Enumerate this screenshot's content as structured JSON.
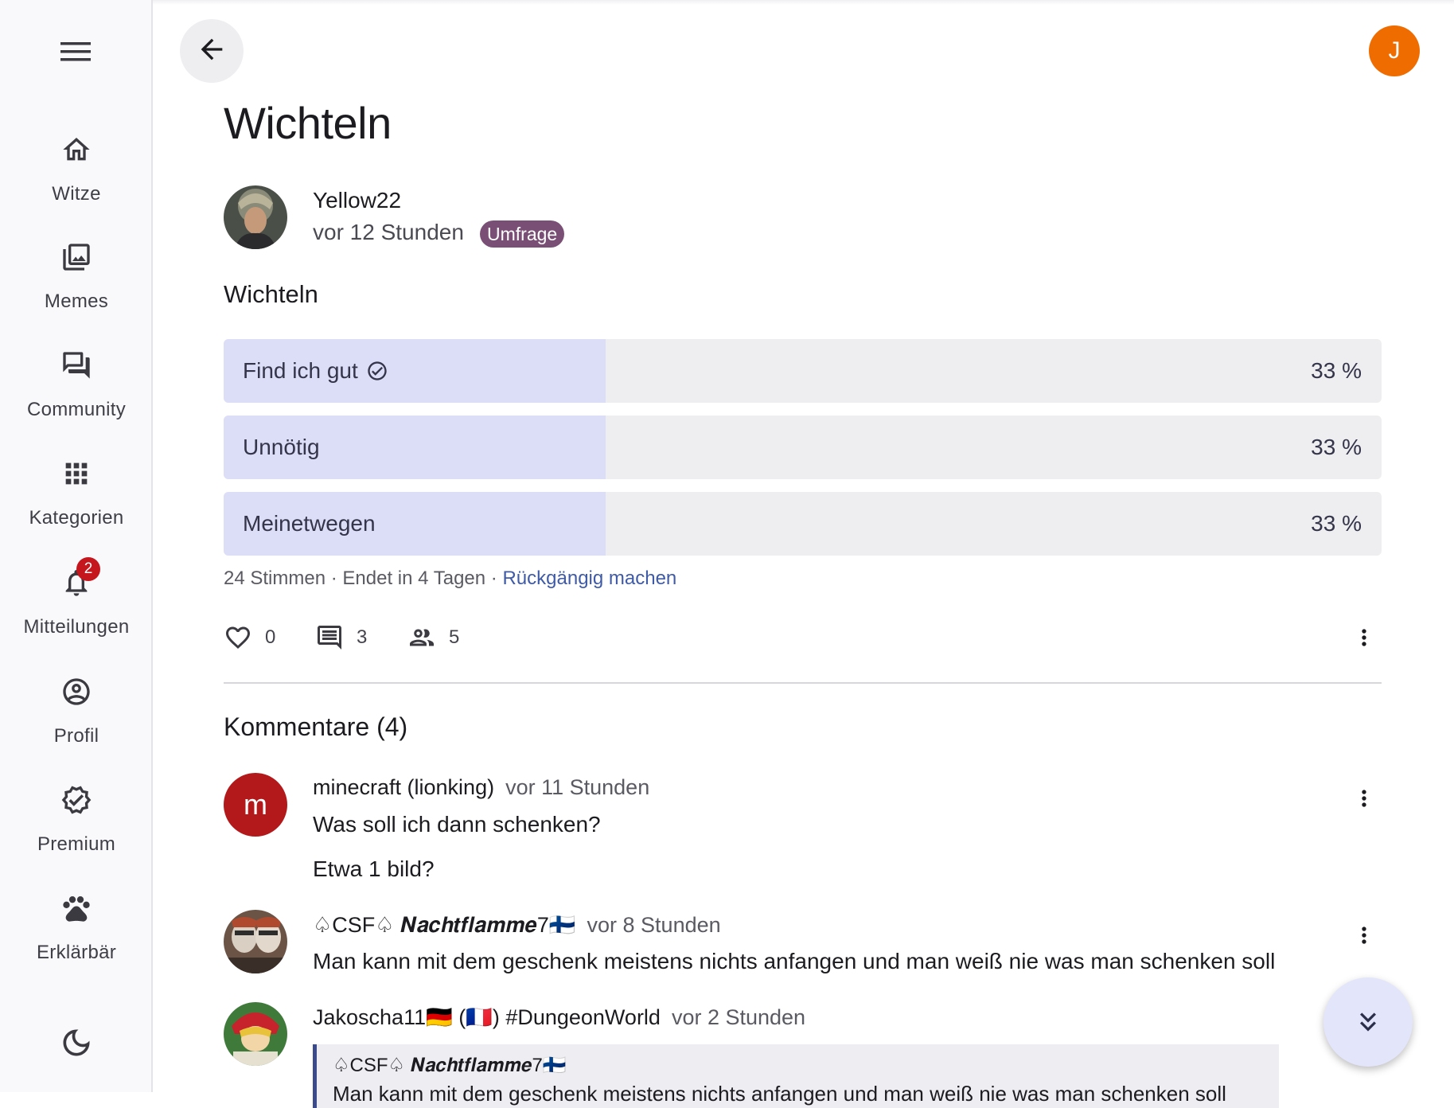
{
  "sidebar": {
    "items": [
      {
        "label": "Witze",
        "icon": "home-icon"
      },
      {
        "label": "Memes",
        "icon": "image-stack-icon"
      },
      {
        "label": "Community",
        "icon": "forum-icon"
      },
      {
        "label": "Kategorien",
        "icon": "apps-grid-icon"
      },
      {
        "label": "Mitteilungen",
        "icon": "bell-icon",
        "badge": "2"
      },
      {
        "label": "Profil",
        "icon": "account-circle-icon"
      },
      {
        "label": "Premium",
        "icon": "verified-icon"
      },
      {
        "label": "Erklärbär",
        "icon": "paw-icon"
      }
    ]
  },
  "header": {
    "user_initial": "J"
  },
  "post": {
    "title": "Wichteln",
    "author": "Yellow22",
    "time": "vor 12 Stunden",
    "type_badge": "Umfrage",
    "poll": {
      "question": "Wichteln",
      "options": [
        {
          "label": "Find ich gut",
          "percent": "33 %",
          "value": 0.33,
          "selected": true
        },
        {
          "label": "Unnötig",
          "percent": "33 %",
          "value": 0.33,
          "selected": false
        },
        {
          "label": "Meinetwegen",
          "percent": "33 %",
          "value": 0.33,
          "selected": false
        }
      ],
      "votes": "24 Stimmen",
      "ends": "Endet in 4 Tagen",
      "undo": "Rückgängig machen"
    },
    "stats": {
      "likes": "0",
      "comments": "3",
      "followers": "5"
    }
  },
  "comments": {
    "title": "Kommentare (4)",
    "items": [
      {
        "initial": "m",
        "author": "minecraft (lionking)",
        "time": "vor 11 Stunden",
        "lines": [
          "Was soll ich dann schenken?",
          "Etwa 1 bild?"
        ]
      },
      {
        "author": "♤CSF♤ 𝑵𝒂𝒄𝒉𝒕𝒇𝒍𝒂𝒎𝒎𝒆7🇫🇮",
        "time": "vor 8 Stunden",
        "lines": [
          "Man kann mit dem geschenk meistens nichts anfangen und man weiß nie was man schenken soll"
        ]
      },
      {
        "author": "Jakoscha11🇩🇪 (🇫🇷) #DungeonWorld",
        "time": "vor 2 Stunden",
        "quote_author": "♤CSF♤ 𝑵𝒂𝒄𝒉𝒕𝒇𝒍𝒂𝒎𝒎𝒆7🇫🇮",
        "quote_text": "Man kann mit dem geschenk meistens nichts anfangen und man weiß nie was man schenken soll"
      }
    ]
  },
  "colors": {
    "accent": "#3f5aa6",
    "poll_fill": "#dcdef7",
    "badge": "#7a4f75",
    "user_avatar": "#ef6c00",
    "comment_avatar": "#b3191a"
  }
}
